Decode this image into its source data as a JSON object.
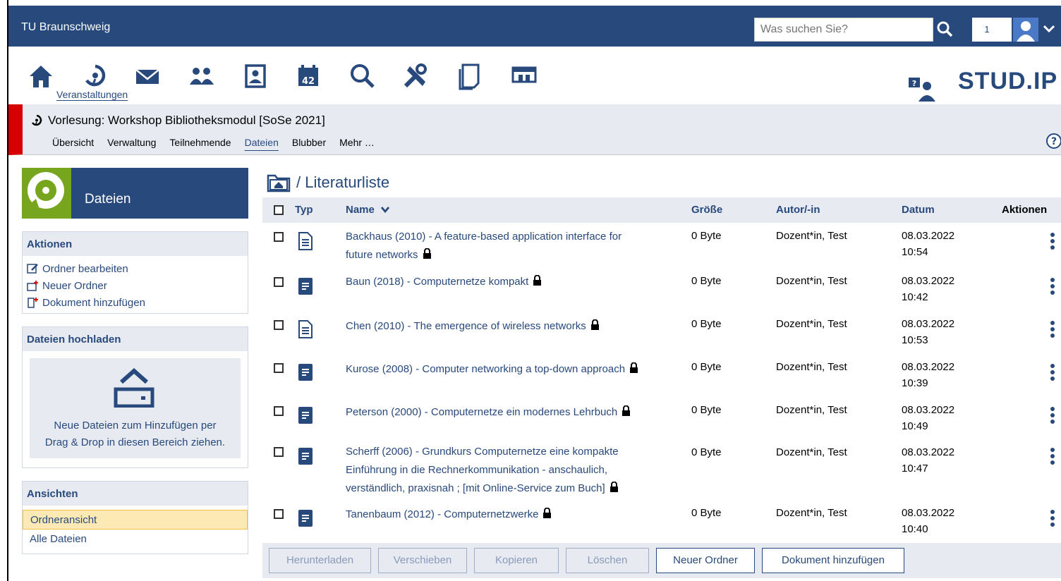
{
  "topbar": {
    "brand": "TU Braunschweig",
    "search_placeholder": "Was suchen Sie?",
    "notification_count": "1"
  },
  "nav": {
    "active_label": "Veranstaltungen",
    "logo_text": "STUD.IP"
  },
  "context": {
    "title": "Vorlesung: Workshop Bibliotheksmodul [SoSe 2021]",
    "tabs": [
      "Übersicht",
      "Verwaltung",
      "Teilnehmende",
      "Dateien",
      "Blubber",
      "Mehr …"
    ],
    "active_tab": "Dateien"
  },
  "sidebar": {
    "header": "Dateien",
    "actions_title": "Aktionen",
    "actions": [
      "Ordner bearbeiten",
      "Neuer Ordner",
      "Dokument hinzufügen"
    ],
    "upload_title": "Dateien hochladen",
    "upload_text_1": "Neue Dateien zum Hinzufügen per",
    "upload_text_2": "Drag & Drop in diesen Bereich ziehen.",
    "views_title": "Ansichten",
    "views": [
      "Ordneransicht",
      "Alle Dateien"
    ]
  },
  "main": {
    "breadcrumb": "/ Literaturliste",
    "columns": {
      "type": "Typ",
      "name": "Name",
      "size": "Größe",
      "author": "Autor/-in",
      "date": "Datum",
      "actions": "Aktionen"
    },
    "rows": [
      {
        "name1": "Backhaus (2010) - A feature-based application interface for",
        "name2": "future networks",
        "name3": "",
        "size": "0 Byte",
        "author": "Dozent*in, Test",
        "date": "08.03.2022",
        "time": "10:54",
        "icon": "document-icon"
      },
      {
        "name1": "Baun (2018) - Computernetze kompakt",
        "name2": "",
        "name3": "",
        "size": "0 Byte",
        "author": "Dozent*in, Test",
        "date": "08.03.2022",
        "time": "10:42",
        "icon": "book-icon"
      },
      {
        "name1": "Chen (2010) - The emergence of wireless networks",
        "name2": "",
        "name3": "",
        "size": "0 Byte",
        "author": "Dozent*in, Test",
        "date": "08.03.2022",
        "time": "10:53",
        "icon": "document-icon"
      },
      {
        "name1": "Kurose (2008) - Computer networking a top-down approach",
        "name2": "",
        "name3": "",
        "size": "0 Byte",
        "author": "Dozent*in, Test",
        "date": "08.03.2022",
        "time": "10:39",
        "icon": "book-icon"
      },
      {
        "name1": "Peterson (2000) - Computernetze ein modernes Lehrbuch",
        "name2": "",
        "name3": "",
        "size": "0 Byte",
        "author": "Dozent*in, Test",
        "date": "08.03.2022",
        "time": "10:49",
        "icon": "book-icon"
      },
      {
        "name1": "Scherff (2006) - Grundkurs Computernetze eine kompakte",
        "name2": "Einführung in die Rechnerkommunikation - anschaulich,",
        "name3": "verständlich, praxisnah ; [mit Online-Service zum Buch]",
        "size": "0 Byte",
        "author": "Dozent*in, Test",
        "date": "08.03.2022",
        "time": "10:47",
        "icon": "book-icon"
      },
      {
        "name1": "Tanenbaum (2012) - Computernetzwerke",
        "name2": "",
        "name3": "",
        "size": "0 Byte",
        "author": "Dozent*in, Test",
        "date": "08.03.2022",
        "time": "10:40",
        "icon": "book-icon"
      }
    ],
    "buttons": [
      "Herunterladen",
      "Verschieben",
      "Kopieren",
      "Löschen",
      "Neuer Ordner",
      "Dokument hinzufügen"
    ]
  },
  "colors": {
    "brand": "#28497c",
    "accent_red": "#d60000",
    "studip_green": "#77a51d",
    "light_bg": "#e7ebf1"
  }
}
